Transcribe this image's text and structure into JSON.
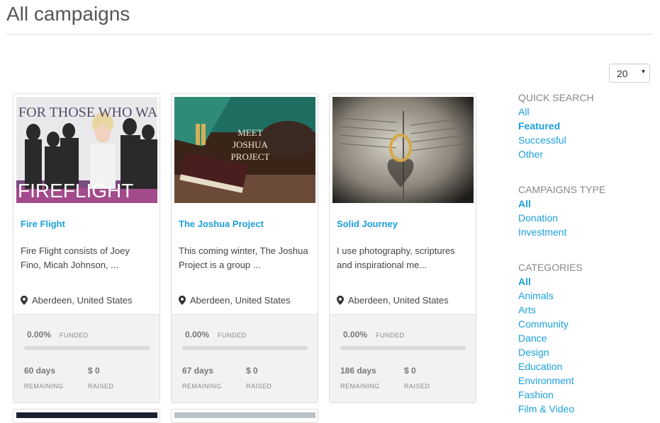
{
  "page": {
    "title": "All campaigns"
  },
  "per_page": {
    "value": "20",
    "caret": "▾"
  },
  "campaigns": [
    {
      "title": "Fire Flight",
      "description": "Fire Flight consists of Joey Fino, Micah Johnson, ...",
      "location": "Aberdeen, United States",
      "funded_pct": "0.00%",
      "funded_label": "FUNDED",
      "progress": 0,
      "days": "60 days",
      "remaining_label": "REMAINING",
      "raised": "$  0",
      "raised_label": "RAISED",
      "image_text_top": "FOR THOSE WHO WAI",
      "image_text_bottom": "FIREFLIGHT"
    },
    {
      "title": "The Joshua Project",
      "description": "This coming winter, The Joshua Project is a group ...",
      "location": "Aberdeen, United States",
      "funded_pct": "0.00%",
      "funded_label": "FUNDED",
      "progress": 0,
      "days": "67 days",
      "remaining_label": "REMAINING",
      "raised": "$  0",
      "raised_label": "RAISED",
      "image_text_lines": [
        "MEET",
        "JOSHUA",
        "PROJECT"
      ]
    },
    {
      "title": "Solid Journey",
      "description": "I use photography, scriptures and inspirational me...",
      "location": "Aberdeen, United States",
      "funded_pct": "0.00%",
      "funded_label": "FUNDED",
      "progress": 0,
      "days": "186 days",
      "remaining_label": "REMAINING",
      "raised": "$  0",
      "raised_label": "RAISED"
    }
  ],
  "sidebar": {
    "quick_search": {
      "heading": "QUICK SEARCH",
      "items": [
        "All",
        "Featured",
        "Successful",
        "Other"
      ],
      "active": "Featured"
    },
    "campaigns_type": {
      "heading": "CAMPAIGNS TYPE",
      "items": [
        "All",
        "Donation",
        "Investment"
      ],
      "active": "All"
    },
    "categories": {
      "heading": "CATEGORIES",
      "items": [
        "All",
        "Animals",
        "Arts",
        "Community",
        "Dance",
        "Design",
        "Education",
        "Environment",
        "Fashion",
        "Film & Video"
      ],
      "active": "All"
    }
  },
  "icons": {
    "location": "map-pin-icon",
    "dropdown": "chevron-down-icon"
  },
  "colors": {
    "link": "#1c9fdb",
    "heading": "#888888"
  }
}
